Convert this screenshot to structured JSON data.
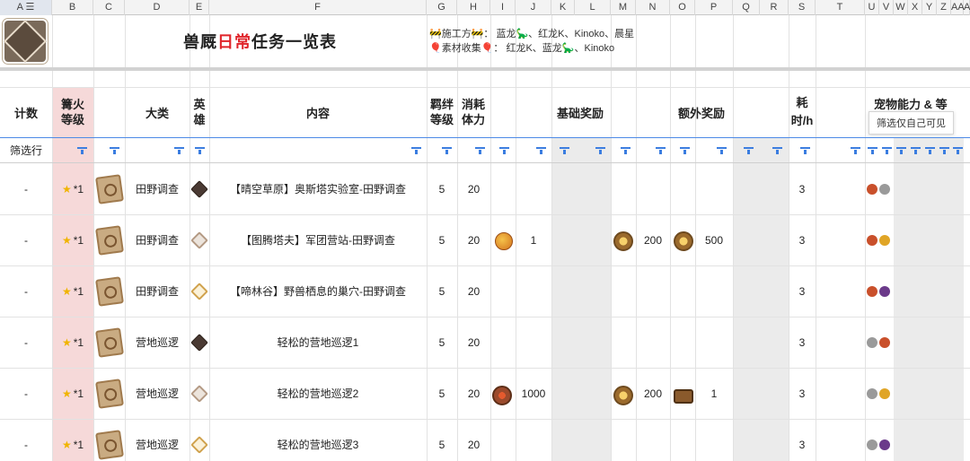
{
  "columns": [
    "A",
    "B",
    "C",
    "D",
    "E",
    "F",
    "G",
    "H",
    "I",
    "J",
    "K",
    "L",
    "M",
    "N",
    "O",
    "P",
    "Q",
    "R",
    "S",
    "T",
    "U",
    "V",
    "W",
    "X",
    "Y",
    "Z",
    "AA",
    "A"
  ],
  "title": {
    "part1": "兽厩",
    "part2": "日常",
    "part3": "任务一览表"
  },
  "credits": {
    "line1": "🚧施工方🚧： 蓝龙🦕、红龙K、Kinoko、晨星",
    "line2": "🎈素材收集🎈： 红龙K、蓝龙🦕、Kinoko"
  },
  "headers": {
    "count": "计数",
    "bonfire": "篝火等级",
    "category": "大类",
    "hero": "英雄",
    "content": "内容",
    "bond": "羁绊等级",
    "stamina": "消耗体力",
    "base_reward": "基础奖励",
    "extra_reward": "额外奖励",
    "time_h": "耗时/h",
    "pet_ability": "宠物能力 & 等"
  },
  "filter_label": "筛选行",
  "tooltip": "筛选仅自己可见",
  "rows": [
    {
      "count": "-",
      "bonfire": "*1",
      "category": "田野调查",
      "hero_gem": "dark",
      "content": "【晴空草原】奥斯塔实验室-田野调查",
      "bond": "5",
      "stamina": "20",
      "time": "3",
      "pets": [
        "red",
        "gray"
      ]
    },
    {
      "count": "-",
      "bonfire": "*1",
      "category": "田野调查",
      "hero_gem": "light",
      "content": "【图腾塔夫】军团营站-田野调查",
      "bond": "5",
      "stamina": "20",
      "time": "3",
      "pets": [
        "red",
        "yellow"
      ]
    },
    {
      "count": "-",
      "bonfire": "*1",
      "category": "田野调查",
      "hero_gem": "gold",
      "content": "【啼林谷】野兽栖息的巢穴-田野调查",
      "bond": "5",
      "stamina": "20",
      "time": "3",
      "pets": [
        "red",
        "purple"
      ]
    },
    {
      "count": "-",
      "bonfire": "*1",
      "category": "营地巡逻",
      "hero_gem": "dark",
      "content": "轻松的营地巡逻1",
      "bond": "5",
      "stamina": "20",
      "time": "3",
      "pets": [
        "gray",
        "red"
      ]
    },
    {
      "count": "-",
      "bonfire": "*1",
      "category": "营地巡逻",
      "hero_gem": "light",
      "content": "轻松的营地巡逻2",
      "bond": "5",
      "stamina": "20",
      "time": "3",
      "pets": [
        "gray",
        "yellow"
      ]
    },
    {
      "count": "-",
      "bonfire": "*1",
      "category": "营地巡逻",
      "hero_gem": "gold",
      "content": "轻松的营地巡逻3",
      "bond": "5",
      "stamina": "20",
      "time": "3",
      "pets": [
        "gray",
        "purple"
      ]
    }
  ],
  "group_rewards": [
    {
      "base_value": "1",
      "extra1_value": "200",
      "extra2_value": "500"
    },
    {
      "base_value": "1000",
      "extra1_value": "200",
      "extra2_value": "1"
    }
  ],
  "colors": {
    "accent": "#3b7de0",
    "red": "#e0252b",
    "pink": "#f6d9d9",
    "gray_col": "#ebebeb"
  }
}
